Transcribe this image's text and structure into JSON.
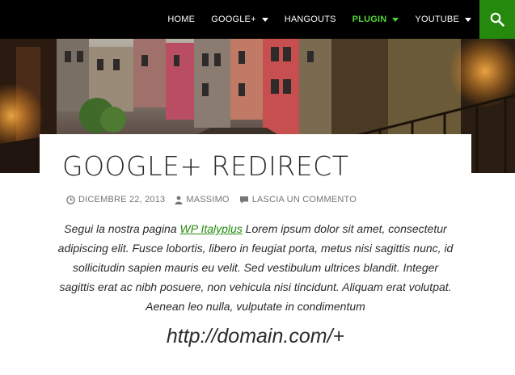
{
  "nav": {
    "items": [
      {
        "label": "HOME",
        "dropdown": false,
        "active": false
      },
      {
        "label": "GOOGLE+",
        "dropdown": true,
        "active": false
      },
      {
        "label": "HANGOUTS",
        "dropdown": false,
        "active": false
      },
      {
        "label": "PLUGIN",
        "dropdown": true,
        "active": true
      },
      {
        "label": "YOUTUBE",
        "dropdown": true,
        "active": false
      }
    ],
    "search_icon": "search-icon"
  },
  "colors": {
    "accent": "#24890d",
    "active_nav": "#55d737",
    "topbar": "#000000"
  },
  "post": {
    "title": "GOOGLE+ REDIRECT",
    "date": "DICEMBRE 22, 2013",
    "author": "MASSIMO",
    "comment_link": "LASCIA UN COMMENTO",
    "body_before_link": "Segui la nostra pagina ",
    "link_text": "WP Italyplus",
    "body_after_link": " Lorem ipsum dolor sit amet, consectetur adipiscing elit. Fusce lobortis, libero in feugiat porta, metus nisi sagittis nunc, id sollicitudin sapien mauris eu velit. Sed vestibulum ultrices blandit. Integer sagittis erat ac nibh posuere, non vehicula nisi tincidunt. Aliquam erat volutpat. Aenean leo nulla, vulputate in condimentum",
    "url_example": "http://domain.com/+"
  }
}
